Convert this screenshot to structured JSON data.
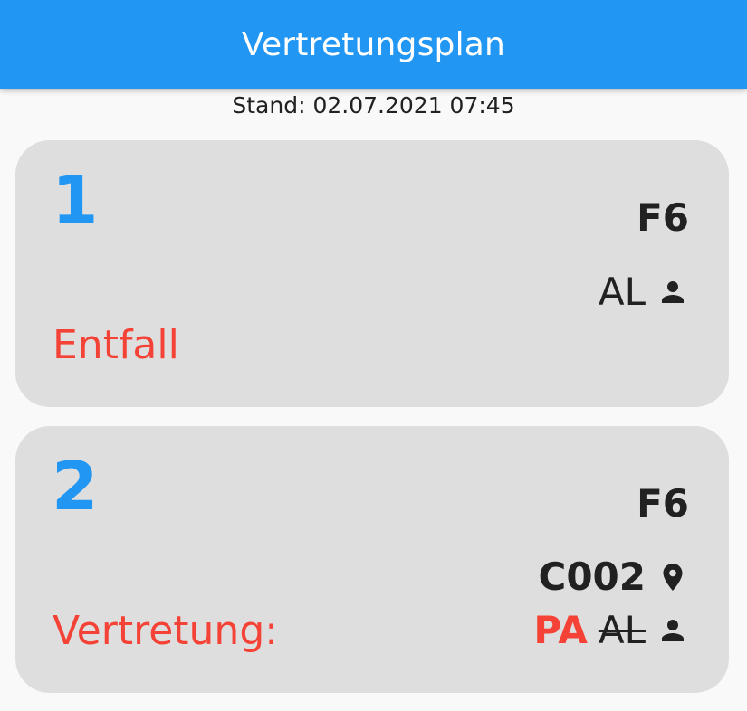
{
  "app_bar": {
    "title": "Vertretungsplan"
  },
  "stand": "Stand: 02.07.2021 07:45",
  "colors": {
    "primary": "#2196f3",
    "accent_red": "#f44336",
    "card_bg": "#dedede",
    "text": "#212121"
  },
  "entries": [
    {
      "lesson": "1",
      "class": "F6",
      "teacher": "AL",
      "teacher_icon": "person-icon",
      "status": "Entfall"
    },
    {
      "lesson": "2",
      "class": "F6",
      "room": "C002",
      "room_icon": "location-pin-icon",
      "substitute_teacher": "PA",
      "original_teacher": "AL",
      "teacher_icon": "person-icon",
      "status": "Vertretung:"
    }
  ]
}
